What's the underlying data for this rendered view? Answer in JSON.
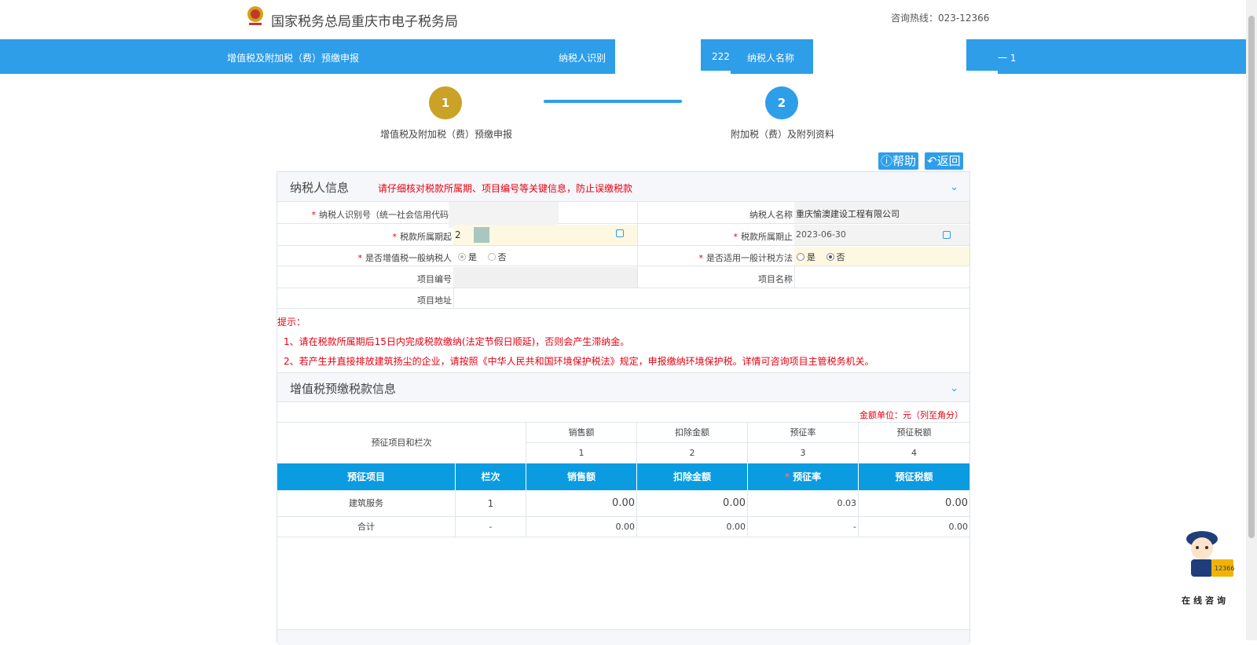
{
  "header": {
    "site_title": "国家税务总局重庆市电子税务局",
    "hotline": "咨询热线：023-12366"
  },
  "bluebar": {
    "form_name": "增值税及附加税（费）预缴申报",
    "taxpayer_id_label": "纳税人识别",
    "taxpayer_id_value_fragment": "222",
    "taxpayer_name_label": "纳税人名称",
    "taxpayer_name_value_fragment": "一 1"
  },
  "steps": [
    {
      "number": "1",
      "label": "增值税及附加税（费）预缴申报",
      "color": "#c9a227"
    },
    {
      "number": "2",
      "label": "附加税（费）及附列资料",
      "color": "#2e9ee9"
    }
  ],
  "toolbar": {
    "help_label": "帮助",
    "back_label": "返回"
  },
  "taxpayer_section": {
    "title": "纳税人信息",
    "warning": "请仔细核对税款所属期、项目编号等关键信息，防止误缴税款",
    "fields": {
      "taxpayer_id_label": "纳税人识别号（统一社会信用代码",
      "taxpayer_name_label": "纳税人名称",
      "taxpayer_name_value": "重庆愉澳建设工程有限公司",
      "period_start_label": "税款所属期起",
      "period_start_value": "2",
      "period_end_label": "税款所属期止",
      "period_end_value": "2023-06-30",
      "general_taxpayer_label": "是否增值税一般纳税人",
      "general_method_label": "是否适用一般计税方法",
      "yes": "是",
      "no": "否",
      "project_no_label": "项目编号",
      "project_name_label": "项目名称",
      "project_address_label": "项目地址"
    },
    "tips_title": "提示：",
    "tips": [
      "1、请在税款所属期后15日内完成税款缴纳(法定节假日顺延)，否则会产生滞纳金。",
      "2、若产生并直接排放建筑扬尘的企业，请按照《中华人民共和国环境保护税法》规定，申报缴纳环境保护税。详情可咨询项目主管税务机关。"
    ]
  },
  "vat_section": {
    "title": "增值税预缴税款信息",
    "unit": "金额单位：元（列至角分）",
    "top_header": {
      "item_col": "预征项目和栏次",
      "cols": [
        "销售额",
        "扣除金额",
        "预征率",
        "预征税额"
      ],
      "col_numbers": [
        "1",
        "2",
        "3",
        "4"
      ]
    },
    "blue_header": [
      "预征项目",
      "栏次",
      "销售额",
      "扣除金额",
      "预征率",
      "预征税额"
    ],
    "rows": [
      {
        "item": "建筑服务",
        "line": "1",
        "sales": "0.00",
        "deduction": "0.00",
        "rate": "0.03",
        "tax": "0.00"
      },
      {
        "item": "合计",
        "line": "-",
        "sales": "0.00",
        "deduction": "0.00",
        "rate": "-",
        "tax": "0.00"
      }
    ]
  },
  "widget": {
    "label": "在线咨询"
  }
}
